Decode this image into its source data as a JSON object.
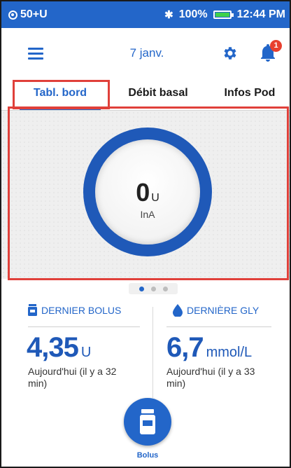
{
  "statusbar": {
    "pod_status": "50+U",
    "battery_percent": "100%",
    "time": "12:44 PM"
  },
  "appbar": {
    "date": "7 janv.",
    "notification_count": "1"
  },
  "tabs": [
    {
      "label": "Tabl. bord",
      "active": true
    },
    {
      "label": "Débit basal",
      "active": false
    },
    {
      "label": "Infos Pod",
      "active": false
    }
  ],
  "dashboard": {
    "iob_value": "0",
    "iob_unit": "U",
    "iob_label": "InA"
  },
  "pager": {
    "count": 3,
    "active_index": 0
  },
  "last_bolus": {
    "label": "DERNIER BOLUS",
    "value": "4,35",
    "unit": "U",
    "sub": "Aujourd'hui (il y a 32 min)"
  },
  "last_bg": {
    "label": "DERNIÈRE GLY",
    "value": "6,7",
    "unit": "mmol/L",
    "sub": "Aujourd'hui (il y a 33 min)"
  },
  "bolus_button": {
    "label": "Bolus"
  },
  "colors": {
    "primary": "#2366c9",
    "ring": "#1f59b8",
    "highlight": "#e0403a",
    "badge": "#e8402f",
    "battery": "#3fd14a"
  }
}
